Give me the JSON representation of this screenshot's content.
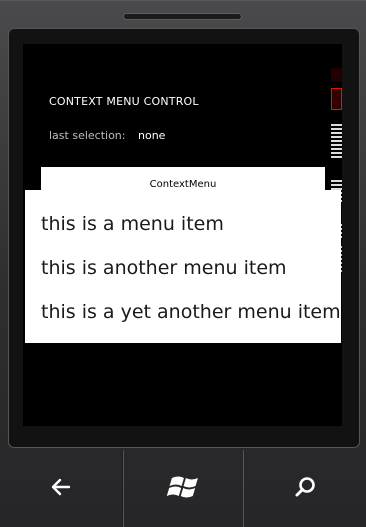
{
  "app": {
    "title": "CONTEXT MENU CONTROL",
    "selection_label": "last selection:",
    "selection_value": "none"
  },
  "context_button": {
    "label": "ContextMenu"
  },
  "context_menu": {
    "items": [
      "this is a menu item",
      "this is another menu item",
      "this is a yet another menu item"
    ]
  },
  "hardware_buttons": {
    "back_icon": "back-arrow-icon",
    "start_icon": "windows-logo-icon",
    "search_icon": "search-icon"
  },
  "colors": {
    "screen_background": "#000000",
    "menu_background": "#ffffff",
    "accent_debug": "#e51400"
  }
}
